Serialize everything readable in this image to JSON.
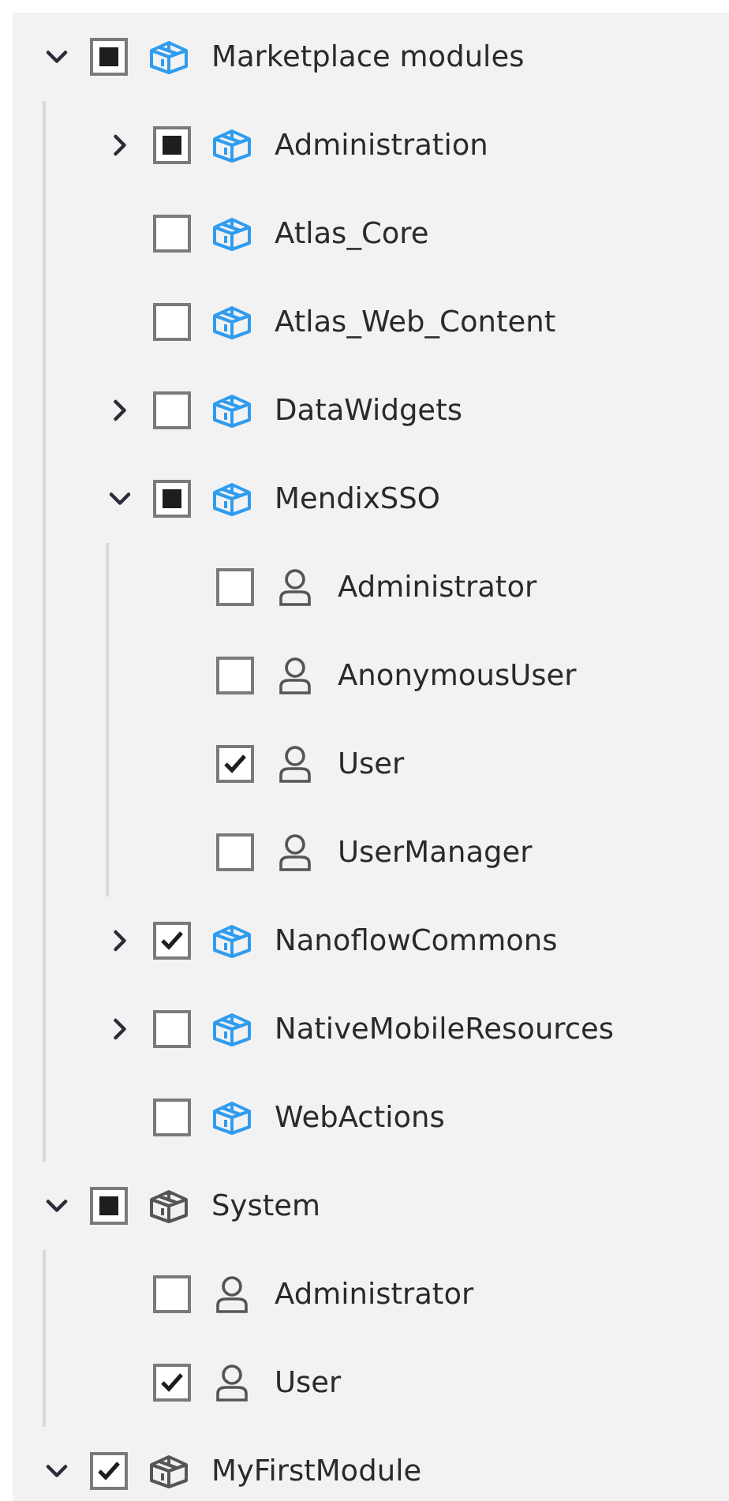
{
  "tree": [
    {
      "label": "Marketplace modules",
      "kind": "marketplace-module",
      "checked": false,
      "indeterminate": true,
      "expanded": true,
      "children": [
        {
          "label": "Administration",
          "kind": "marketplace-module",
          "checked": false,
          "indeterminate": true,
          "expanded": false
        },
        {
          "label": "Atlas_Core",
          "kind": "marketplace-module",
          "checked": false,
          "indeterminate": false
        },
        {
          "label": "Atlas_Web_Content",
          "kind": "marketplace-module",
          "checked": false,
          "indeterminate": false
        },
        {
          "label": "DataWidgets",
          "kind": "marketplace-module",
          "checked": false,
          "indeterminate": false,
          "expanded": false
        },
        {
          "label": "MendixSSO",
          "kind": "marketplace-module",
          "checked": false,
          "indeterminate": true,
          "expanded": true,
          "children": [
            {
              "label": "Administrator",
              "kind": "role",
              "checked": false,
              "indeterminate": false
            },
            {
              "label": "AnonymousUser",
              "kind": "role",
              "checked": false,
              "indeterminate": false
            },
            {
              "label": "User",
              "kind": "role",
              "checked": true,
              "indeterminate": false
            },
            {
              "label": "UserManager",
              "kind": "role",
              "checked": false,
              "indeterminate": false
            }
          ]
        },
        {
          "label": "NanoflowCommons",
          "kind": "marketplace-module",
          "checked": true,
          "indeterminate": false,
          "expanded": false
        },
        {
          "label": "NativeMobileResources",
          "kind": "marketplace-module",
          "checked": false,
          "indeterminate": false,
          "expanded": false
        },
        {
          "label": "WebActions",
          "kind": "marketplace-module",
          "checked": false,
          "indeterminate": false
        }
      ]
    },
    {
      "label": "System",
      "kind": "module",
      "checked": false,
      "indeterminate": true,
      "expanded": true,
      "children": [
        {
          "label": "Administrator",
          "kind": "role",
          "checked": false,
          "indeterminate": false
        },
        {
          "label": "User",
          "kind": "role",
          "checked": true,
          "indeterminate": false
        }
      ]
    },
    {
      "label": "MyFirstModule",
      "kind": "module",
      "checked": true,
      "indeterminate": false,
      "expanded": true
    }
  ]
}
